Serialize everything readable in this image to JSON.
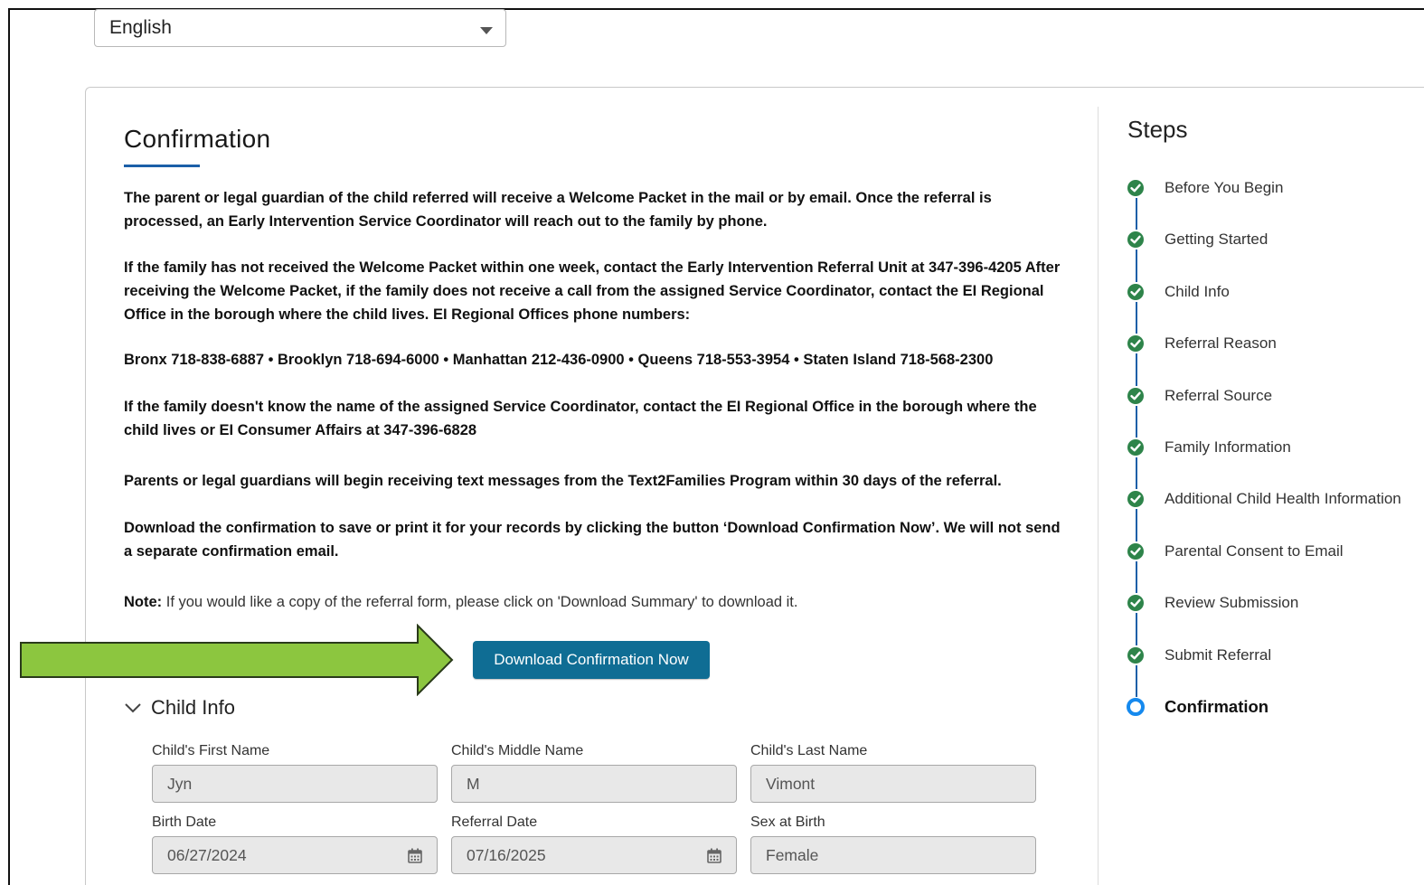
{
  "language_select": {
    "value": "English"
  },
  "confirmation": {
    "title": "Confirmation",
    "paragraphs": [
      "The parent or legal guardian of the child referred will receive a Welcome Packet in the mail or by email. Once the referral is processed, an Early Intervention Service Coordinator will reach out to the family by phone.",
      "If the family has not received the Welcome Packet within one week, contact the Early Intervention Referral Unit at 347-396-4205 After receiving the Welcome Packet, if the family does not receive a call from the assigned Service Coordinator, contact the EI Regional Office in the borough where the child lives. EI Regional Offices phone numbers:",
      "Bronx 718-838-6887 • Brooklyn 718-694-6000 • Manhattan 212-436-0900 • Queens 718-553-3954 • Staten Island 718-568-2300",
      "If the family doesn't know the name of the assigned Service Coordinator, contact the EI Regional Office in the borough where the child lives or EI Consumer Affairs at 347-396-6828",
      "Parents or legal guardians will begin receiving text messages from the Text2Families Program within 30 days of the referral.",
      "Download the confirmation to save or print it for your records by clicking the button ‘Download Confirmation Now’. We will not send a separate confirmation email."
    ],
    "note_label": "Note:",
    "note_text": " If you would like a copy of the referral form, please click on 'Download Summary' to download it.",
    "download_button": "Download Confirmation Now"
  },
  "child_info": {
    "section_title": "Child Info",
    "fields": {
      "first_name": {
        "label": "Child's First Name",
        "value": "Jyn"
      },
      "middle_name": {
        "label": "Child's Middle Name",
        "value": "M"
      },
      "last_name": {
        "label": "Child's Last Name",
        "value": "Vimont"
      },
      "birth_date": {
        "label": "Birth Date",
        "value": "06/27/2024"
      },
      "referral_date": {
        "label": "Referral Date",
        "value": "07/16/2025"
      },
      "sex_at_birth": {
        "label": "Sex at Birth",
        "value": "Female"
      }
    }
  },
  "steps": {
    "title": "Steps",
    "items": [
      {
        "label": "Before You Begin",
        "state": "complete"
      },
      {
        "label": "Getting Started",
        "state": "complete"
      },
      {
        "label": "Child Info",
        "state": "complete"
      },
      {
        "label": "Referral Reason",
        "state": "complete"
      },
      {
        "label": "Referral Source",
        "state": "complete"
      },
      {
        "label": "Family Information",
        "state": "complete"
      },
      {
        "label": "Additional Child Health Information",
        "state": "complete"
      },
      {
        "label": "Parental Consent to Email",
        "state": "complete"
      },
      {
        "label": "Review Submission",
        "state": "complete"
      },
      {
        "label": "Submit Referral",
        "state": "complete"
      },
      {
        "label": "Confirmation",
        "state": "current"
      }
    ]
  },
  "colors": {
    "accent": "#1b5fa8",
    "button": "#0f6d94",
    "step_complete": "#2e844a",
    "step_current": "#1589ee",
    "annotation_arrow": "#8cc63f"
  },
  "icons": [
    "chevron-down-icon",
    "check-circle-icon",
    "calendar-icon",
    "caret-down-icon",
    "annotation-arrow"
  ]
}
